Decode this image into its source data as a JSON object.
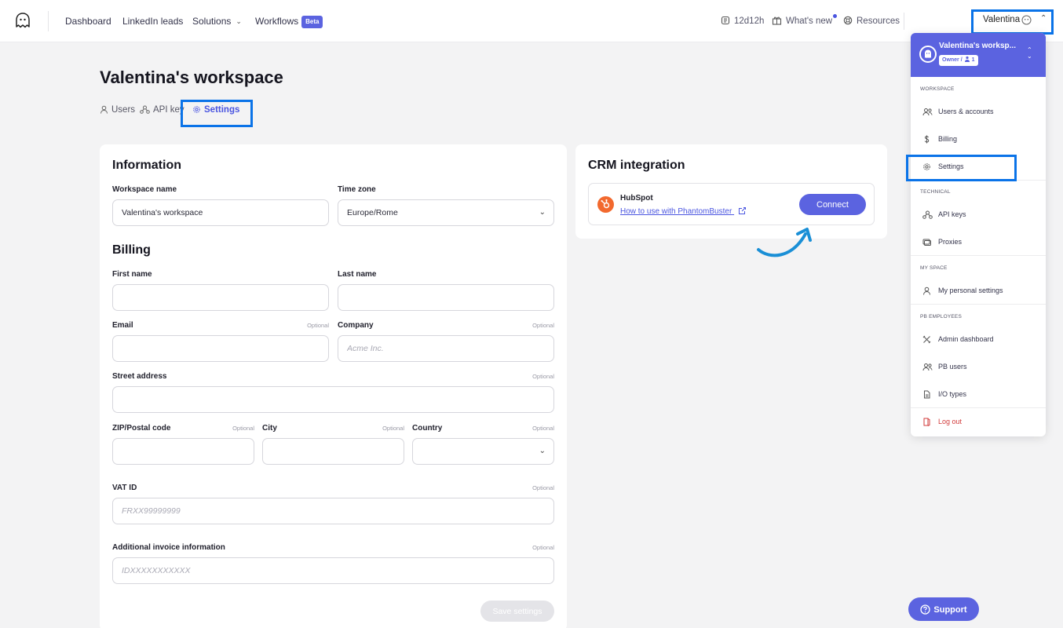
{
  "nav": {
    "dashboard": "Dashboard",
    "linkedin_leads": "LinkedIn leads",
    "solutions": "Solutions",
    "workflows": "Workflows",
    "beta": "Beta",
    "time_left": "12d12h",
    "whats_new": "What's new",
    "resources": "Resources",
    "user": "Valentina"
  },
  "page": {
    "title": "Valentina's workspace",
    "tabs": [
      "Users",
      "API key",
      "Settings"
    ]
  },
  "information": {
    "heading": "Information",
    "workspace_name_label": "Workspace name",
    "workspace_name_value": "Valentina's workspace",
    "time_zone_label": "Time zone",
    "time_zone_value": "Europe/Rome"
  },
  "billing": {
    "heading": "Billing",
    "first_name_label": "First name",
    "last_name_label": "Last name",
    "email_label": "Email",
    "company_label": "Company",
    "company_placeholder": "Acme Inc.",
    "street_label": "Street address",
    "zip_label": "ZIP/Postal code",
    "city_label": "City",
    "country_label": "Country",
    "vat_label": "VAT ID",
    "vat_placeholder": "FRXX99999999",
    "additional_label": "Additional invoice information",
    "additional_placeholder": "IDXXXXXXXXXXX",
    "optional": "Optional",
    "save_label": "Save settings"
  },
  "crm": {
    "heading": "CRM integration",
    "provider": "HubSpot",
    "link": "How to use with PhantomBuster",
    "connect": "Connect"
  },
  "dropdown": {
    "workspace": "Valentina's worksp...",
    "role": "Owner /",
    "members": "1",
    "sections": {
      "workspace": "WORKSPACE",
      "technical": "TECHNICAL",
      "my_space": "MY SPACE",
      "pb_employees": "PB EMPLOYEES"
    },
    "items": {
      "users_accounts": "Users & accounts",
      "billing": "Billing",
      "settings": "Settings",
      "api_keys": "API keys",
      "proxies": "Proxies",
      "personal_settings": "My personal settings",
      "admin_dashboard": "Admin dashboard",
      "pb_users": "PB users",
      "io_types": "I/O types",
      "log_out": "Log out"
    }
  },
  "support": "Support",
  "colors": {
    "accent": "#5b63e0",
    "highlight": "#0a73e8",
    "hubspot": "#f2692e",
    "logout": "#d23b3b"
  }
}
